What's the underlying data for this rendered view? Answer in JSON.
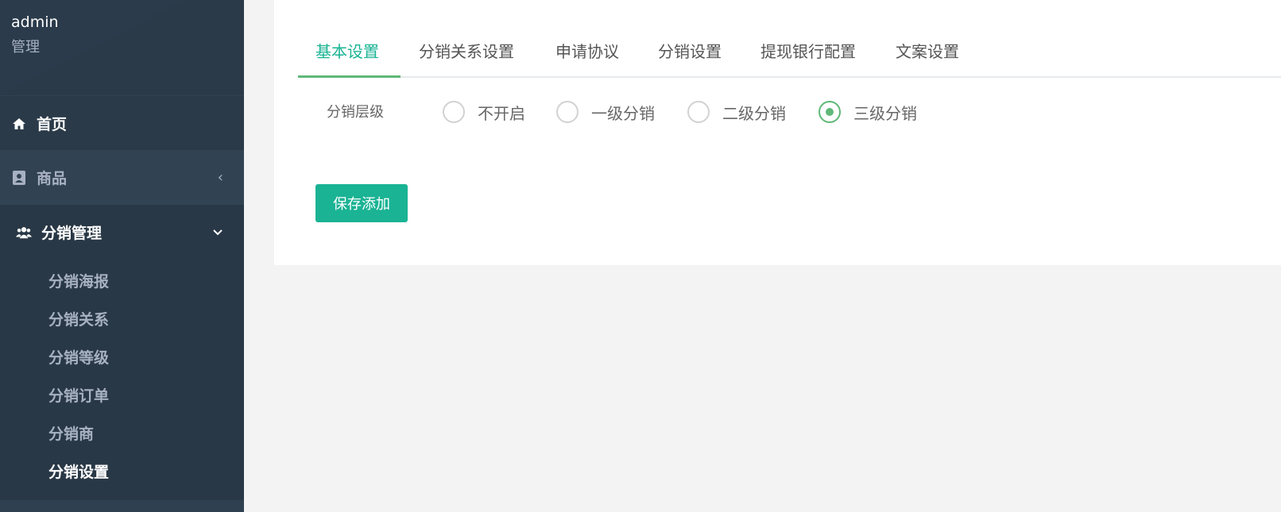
{
  "profile": {
    "username": "admin",
    "role": "管理"
  },
  "nav": {
    "home": {
      "label": "首页",
      "icon": "home-icon"
    },
    "goods": {
      "label": "商品",
      "icon": "contact-card-icon",
      "arrow": "‹"
    },
    "distribution": {
      "label": "分销管理",
      "icon": "users-icon",
      "arrow": "⌄",
      "children": [
        "分销海报",
        "分销关系",
        "分销等级",
        "分销订单",
        "分销商",
        "分销设置"
      ],
      "active_child": "分销设置"
    }
  },
  "tabs": [
    "基本设置",
    "分销关系设置",
    "申请协议",
    "分销设置",
    "提现银行配置",
    "文案设置"
  ],
  "active_tab": "基本设置",
  "form": {
    "level_label": "分销层级",
    "options": [
      "不开启",
      "一级分销",
      "二级分销",
      "三级分销"
    ],
    "selected": "三级分销",
    "save_label": "保存添加"
  },
  "colors": {
    "sidebar": "#2f4050",
    "accent": "#1ab394",
    "radio": "#5fb878"
  }
}
